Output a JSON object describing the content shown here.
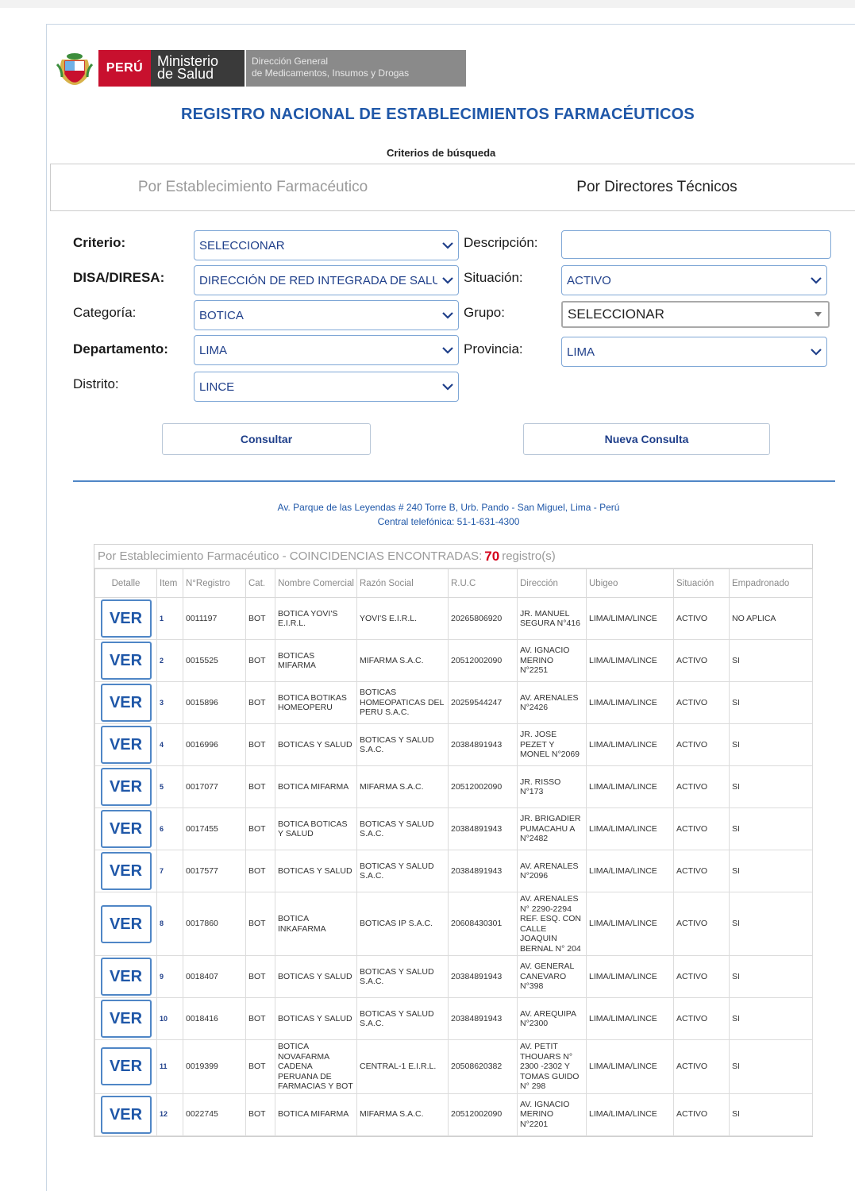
{
  "header": {
    "peru": "PERÚ",
    "minsa_line1": "Ministerio",
    "minsa_line2": "de Salud",
    "digemid_line1": "Dirección General",
    "digemid_line2": "de Medicamentos, Insumos y Drogas",
    "title": "REGISTRO NACIONAL DE ESTABLECIMIENTOS FARMACÉUTICOS",
    "criteria_label": "Criterios de búsqueda"
  },
  "tabs": [
    {
      "label": "Por Establecimiento Farmacéutico",
      "active": false
    },
    {
      "label": "Por Directores Técnicos",
      "active": true
    }
  ],
  "form": {
    "criterio": {
      "label": "Criterio:",
      "value": "SELECCIONAR"
    },
    "descripcion": {
      "label": "Descripción:",
      "value": ""
    },
    "disa": {
      "label": "DISA/DIRESA:",
      "value": "DIRECCIÓN DE RED INTEGRADA DE SALUD LIMA CENTRO"
    },
    "situacion": {
      "label": "Situación:",
      "value": "ACTIVO"
    },
    "categoria": {
      "label": "Categoría:",
      "value": "BOTICA"
    },
    "grupo": {
      "label": "Grupo:",
      "value": "SELECCIONAR"
    },
    "departamento": {
      "label": "Departamento:",
      "value": "LIMA"
    },
    "provincia": {
      "label": "Provincia:",
      "value": "LIMA"
    },
    "distrito": {
      "label": "Distrito:",
      "value": "LINCE"
    }
  },
  "buttons": {
    "consultar": "Consultar",
    "nueva": "Nueva Consulta"
  },
  "footer": {
    "address": "Av. Parque de las Leyendas # 240 Torre B, Urb. Pando - San Miguel, Lima - Perú",
    "phone": "Central telefónica: 51-1-631-4300"
  },
  "results": {
    "title_prefix": "Por Establecimiento Farmacéutico - COINCIDENCIAS ENCONTRADAS:",
    "count": "70",
    "title_suffix": "registro(s)",
    "columns": [
      "Detalle",
      "Item",
      "N°Registro",
      "Cat.",
      "Nombre Comercial",
      "Razón Social",
      "R.U.C",
      "Dirección",
      "Ubigeo",
      "Situación",
      "Empadronado"
    ],
    "ver_label": "Ver",
    "rows": [
      {
        "item": "1",
        "registro": "0011197",
        "cat": "BOT",
        "nombre": "BOTICA YOVI'S E.I.R.L.",
        "razon": "YOVI'S E.I.R.L.",
        "ruc": "20265806920",
        "direccion": "JR. MANUEL SEGURA N°416",
        "ubigeo": "LIMA/LIMA/LINCE",
        "situacion": "ACTIVO",
        "empadronado": "NO APLICA"
      },
      {
        "item": "2",
        "registro": "0015525",
        "cat": "BOT",
        "nombre": "BOTICAS MIFARMA",
        "razon": "MIFARMA S.A.C.",
        "ruc": "20512002090",
        "direccion": "AV. IGNACIO MERINO N°2251",
        "ubigeo": "LIMA/LIMA/LINCE",
        "situacion": "ACTIVO",
        "empadronado": "SI"
      },
      {
        "item": "3",
        "registro": "0015896",
        "cat": "BOT",
        "nombre": "BOTICA BOTIKAS HOMEOPERU",
        "razon": "BOTICAS HOMEOPATICAS DEL PERU S.A.C.",
        "ruc": "20259544247",
        "direccion": "AV. ARENALES N°2426",
        "ubigeo": "LIMA/LIMA/LINCE",
        "situacion": "ACTIVO",
        "empadronado": "SI"
      },
      {
        "item": "4",
        "registro": "0016996",
        "cat": "BOT",
        "nombre": "BOTICAS Y SALUD",
        "razon": "BOTICAS Y SALUD S.A.C.",
        "ruc": "20384891943",
        "direccion": "JR. JOSE PEZET Y MONEL N°2069",
        "ubigeo": "LIMA/LIMA/LINCE",
        "situacion": "ACTIVO",
        "empadronado": "SI"
      },
      {
        "item": "5",
        "registro": "0017077",
        "cat": "BOT",
        "nombre": "BOTICA MIFARMA",
        "razon": "MIFARMA S.A.C.",
        "ruc": "20512002090",
        "direccion": "JR. RISSO N°173",
        "ubigeo": "LIMA/LIMA/LINCE",
        "situacion": "ACTIVO",
        "empadronado": "SI"
      },
      {
        "item": "6",
        "registro": "0017455",
        "cat": "BOT",
        "nombre": "BOTICA BOTICAS Y SALUD",
        "razon": "BOTICAS Y SALUD S.A.C.",
        "ruc": "20384891943",
        "direccion": "JR. BRIGADIER PUMACAHU A N°2482",
        "ubigeo": "LIMA/LIMA/LINCE",
        "situacion": "ACTIVO",
        "empadronado": "SI"
      },
      {
        "item": "7",
        "registro": "0017577",
        "cat": "BOT",
        "nombre": "BOTICAS Y SALUD",
        "razon": "BOTICAS Y SALUD S.A.C.",
        "ruc": "20384891943",
        "direccion": "AV. ARENALES N°2096",
        "ubigeo": "LIMA/LIMA/LINCE",
        "situacion": "ACTIVO",
        "empadronado": "SI"
      },
      {
        "item": "8",
        "registro": "0017860",
        "cat": "BOT",
        "nombre": "BOTICA INKAFARMA",
        "razon": "BOTICAS IP S.A.C.",
        "ruc": "20608430301",
        "direccion": "AV. ARENALES N° 2290-2294 REF. ESQ. CON CALLE JOAQUIN BERNAL N° 204",
        "ubigeo": "LIMA/LIMA/LINCE",
        "situacion": "ACTIVO",
        "empadronado": "SI"
      },
      {
        "item": "9",
        "registro": "0018407",
        "cat": "BOT",
        "nombre": "BOTICAS Y SALUD",
        "razon": "BOTICAS Y SALUD S.A.C.",
        "ruc": "20384891943",
        "direccion": "AV. GENERAL CANEVARO N°398",
        "ubigeo": "LIMA/LIMA/LINCE",
        "situacion": "ACTIVO",
        "empadronado": "SI"
      },
      {
        "item": "10",
        "registro": "0018416",
        "cat": "BOT",
        "nombre": "BOTICAS Y SALUD",
        "razon": "BOTICAS Y SALUD S.A.C.",
        "ruc": "20384891943",
        "direccion": "AV. AREQUIPA N°2300",
        "ubigeo": "LIMA/LIMA/LINCE",
        "situacion": "ACTIVO",
        "empadronado": "SI"
      },
      {
        "item": "11",
        "registro": "0019399",
        "cat": "BOT",
        "nombre": "BOTICA NOVAFARMA CADENA PERUANA DE FARMACIAS Y BOT",
        "razon": "CENTRAL-1 E.I.R.L.",
        "ruc": "20508620382",
        "direccion": "AV. PETIT THOUARS N° 2300 -2302 Y TOMAS GUIDO N° 298",
        "ubigeo": "LIMA/LIMA/LINCE",
        "situacion": "ACTIVO",
        "empadronado": "SI"
      },
      {
        "item": "12",
        "registro": "0022745",
        "cat": "BOT",
        "nombre": "BOTICA MIFARMA",
        "razon": "MIFARMA S.A.C.",
        "ruc": "20512002090",
        "direccion": "AV. IGNACIO MERINO N°2201",
        "ubigeo": "LIMA/LIMA/LINCE",
        "situacion": "ACTIVO",
        "empadronado": "SI"
      }
    ]
  },
  "colors": {
    "accent_blue": "#1f57a8",
    "peru_red": "#c8102e",
    "count_red": "#d4001a"
  }
}
